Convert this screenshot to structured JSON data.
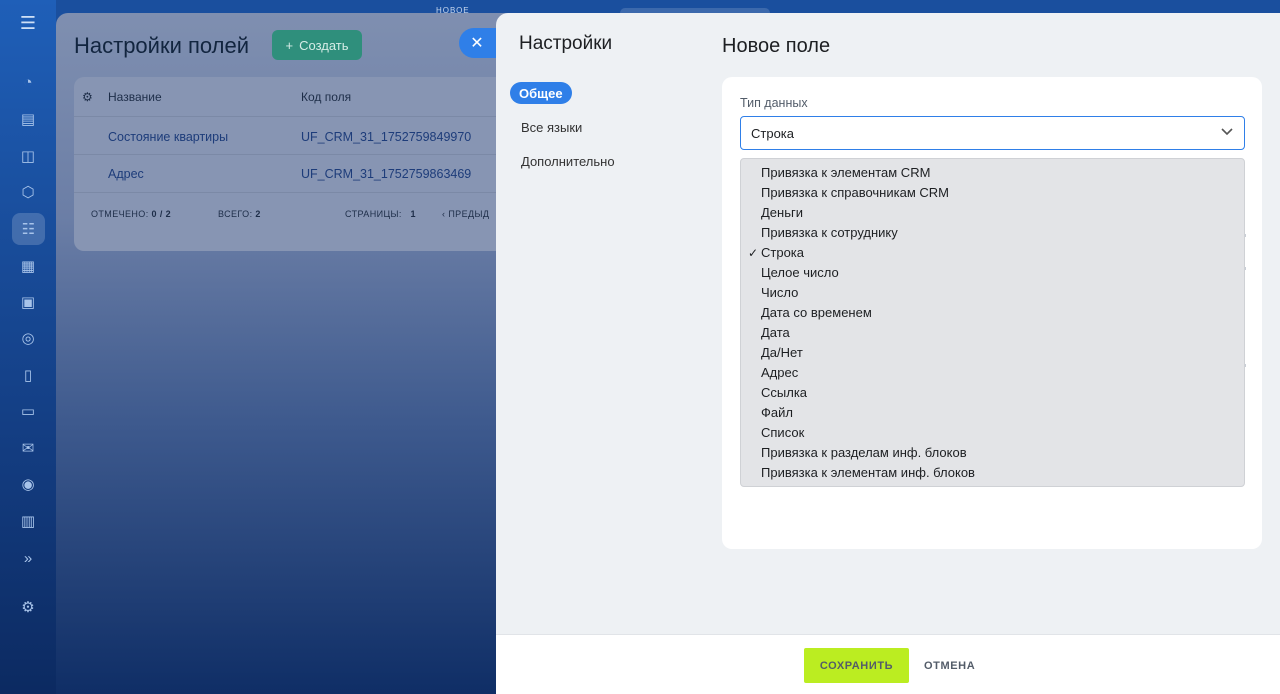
{
  "topbar": {
    "note": "НОВОЕ"
  },
  "background_page": {
    "title": "Настройки полей",
    "create_button": "Создать",
    "columns": [
      "Название",
      "Код поля"
    ],
    "rows": [
      {
        "name": "Состояние квартиры",
        "code": "UF_CRM_31_1752759849970"
      },
      {
        "name": "Адрес",
        "code": "UF_CRM_31_1752759863469"
      }
    ],
    "footer": {
      "marked_label": "ОТМЕЧЕНО:",
      "marked_value": "0 / 2",
      "total_label": "ВСЕГО:",
      "total_value": "2",
      "pages_label": "СТРАНИЦЫ:",
      "pages_value": "1",
      "prev_label": "ПРЕДЫД"
    }
  },
  "panel": {
    "title": "Настройки",
    "nav": [
      {
        "label": "Общее",
        "active": true
      },
      {
        "label": "Все языки",
        "active": false
      },
      {
        "label": "Дополнительно",
        "active": false
      }
    ],
    "form_title": "Новое поле",
    "field_label": "Тип данных",
    "selected_value": "Строка",
    "options": [
      "Привязка к элементам CRM",
      "Привязка к справочникам CRM",
      "Деньги",
      "Привязка к сотруднику",
      "Строка",
      "Целое число",
      "Число",
      "Дата со временем",
      "Дата",
      "Да/Нет",
      "Адрес",
      "Ссылка",
      "Файл",
      "Список",
      "Привязка к разделам инф. блоков",
      "Привязка к элементам инф. блоков"
    ],
    "selected_index": 4,
    "save_label": "СОХРАНИТЬ",
    "cancel_label": "ОТМЕНА"
  },
  "colors": {
    "accent": "#2f7fe8",
    "save": "#bbed21",
    "dropdown_bg": "#e3e4e7"
  },
  "icons": [
    "menu-icon",
    "close-icon",
    "plus-icon",
    "gear-icon",
    "chevron-down-icon",
    "check-icon"
  ]
}
